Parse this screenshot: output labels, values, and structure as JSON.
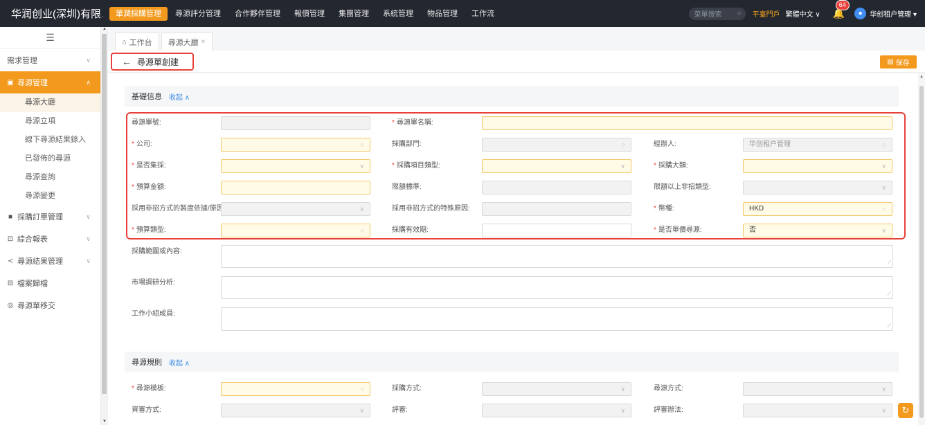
{
  "header": {
    "brand": "华润创业(深圳)有限...",
    "nav": [
      "華潤採購管理",
      "尋源評分管理",
      "合作夥伴管理",
      "報價管理",
      "集團管理",
      "系統管理",
      "物品管理",
      "工作流"
    ],
    "search_placeholder": "菜單搜索",
    "portal": "平臺門戶",
    "language": "繁體中文 ∨",
    "notifications": "64",
    "user": "华创租户管理 ▾"
  },
  "sidebar": {
    "groups": [
      {
        "label": "需求管理"
      },
      {
        "label": "尋源管理",
        "children": [
          "尋源大廳",
          "尋源立項",
          "線下尋源結果錄入",
          "已發佈的尋源",
          "尋源查詢",
          "尋源變更"
        ]
      },
      {
        "label": "採購訂單管理"
      },
      {
        "label": "綜合報表"
      },
      {
        "label": "尋源結果管理"
      },
      {
        "label": "檔案歸檔"
      },
      {
        "label": "尋源單移交"
      }
    ]
  },
  "tabs": [
    {
      "label": "工作台"
    },
    {
      "label": "尋源大廳"
    }
  ],
  "page": {
    "title": "尋源單創建",
    "save_label": "保存"
  },
  "sections": {
    "basic": {
      "title": "基礎信息",
      "collapse": "收起"
    },
    "rules": {
      "title": "尋源規則",
      "collapse": "收起"
    }
  },
  "fields": {
    "source_no": "尋源單號:",
    "source_name": "尋源單名稱:",
    "company": "公司:",
    "dept": "採購部門:",
    "handler": "經辦人:",
    "handler_value": "华创租户管理",
    "centralized": "是否集採:",
    "project_type": "採購項目類型:",
    "category": "採購大類:",
    "budget": "預算金額:",
    "limit_std": "限額標準:",
    "above_limit": "限額以上非招類型:",
    "non_tender_basis": "採用非招方式的製度依據/原因:",
    "non_tender_reason": "採用非招方式的特殊原因:",
    "currency": "幣種:",
    "currency_value": "HKD",
    "budget_type": "預算類型:",
    "validity": "採購有效期:",
    "single_source": "是否單價尋源:",
    "single_source_value": "否",
    "scope": "採購範圍或內容:",
    "market": "市場調研分析:",
    "team": "工作小組成員:",
    "template": "尋源模板:",
    "purchase_method": "採購方式:",
    "source_method": "尋源方式:",
    "qualification": "資審方式:",
    "review": "評審:",
    "review_method": "評審辦法:"
  }
}
